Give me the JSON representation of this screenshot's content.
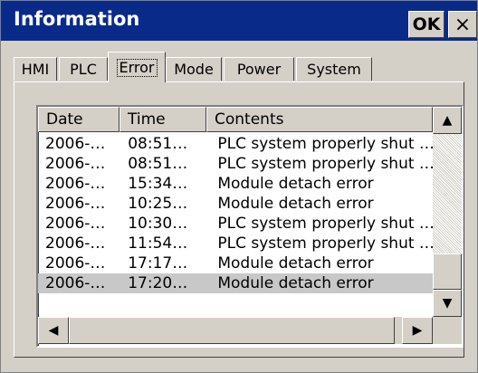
{
  "window": {
    "title": "Information",
    "ok_label": "OK",
    "close_label": "×"
  },
  "tabs": [
    {
      "label": "HMI",
      "active": false
    },
    {
      "label": "PLC",
      "active": false
    },
    {
      "label": "Error",
      "active": true
    },
    {
      "label": "Mode",
      "active": false
    },
    {
      "label": "Power",
      "active": false
    },
    {
      "label": "System",
      "active": false
    }
  ],
  "list": {
    "columns": [
      "Date",
      "Time",
      "Contents"
    ],
    "rows": [
      {
        "date": "2006-…",
        "time": "08:51…",
        "contents": "PLC system properly shut …"
      },
      {
        "date": "2006-…",
        "time": "08:51…",
        "contents": "PLC system properly shut …"
      },
      {
        "date": "2006-…",
        "time": "15:34…",
        "contents": "Module detach error"
      },
      {
        "date": "2006-…",
        "time": "10:25…",
        "contents": "Module detach error"
      },
      {
        "date": "2006-…",
        "time": "10:30…",
        "contents": "PLC system properly shut …"
      },
      {
        "date": "2006-…",
        "time": "11:54…",
        "contents": "PLC system properly shut …"
      },
      {
        "date": "2006-…",
        "time": "17:17…",
        "contents": "Module detach error"
      },
      {
        "date": "2006-…",
        "time": "17:20…",
        "contents": "Module detach error",
        "selected": true
      }
    ]
  },
  "scrollbars": {
    "up_arrow": "▲",
    "down_arrow": "▼",
    "left_arrow": "◀",
    "right_arrow": "▶"
  }
}
